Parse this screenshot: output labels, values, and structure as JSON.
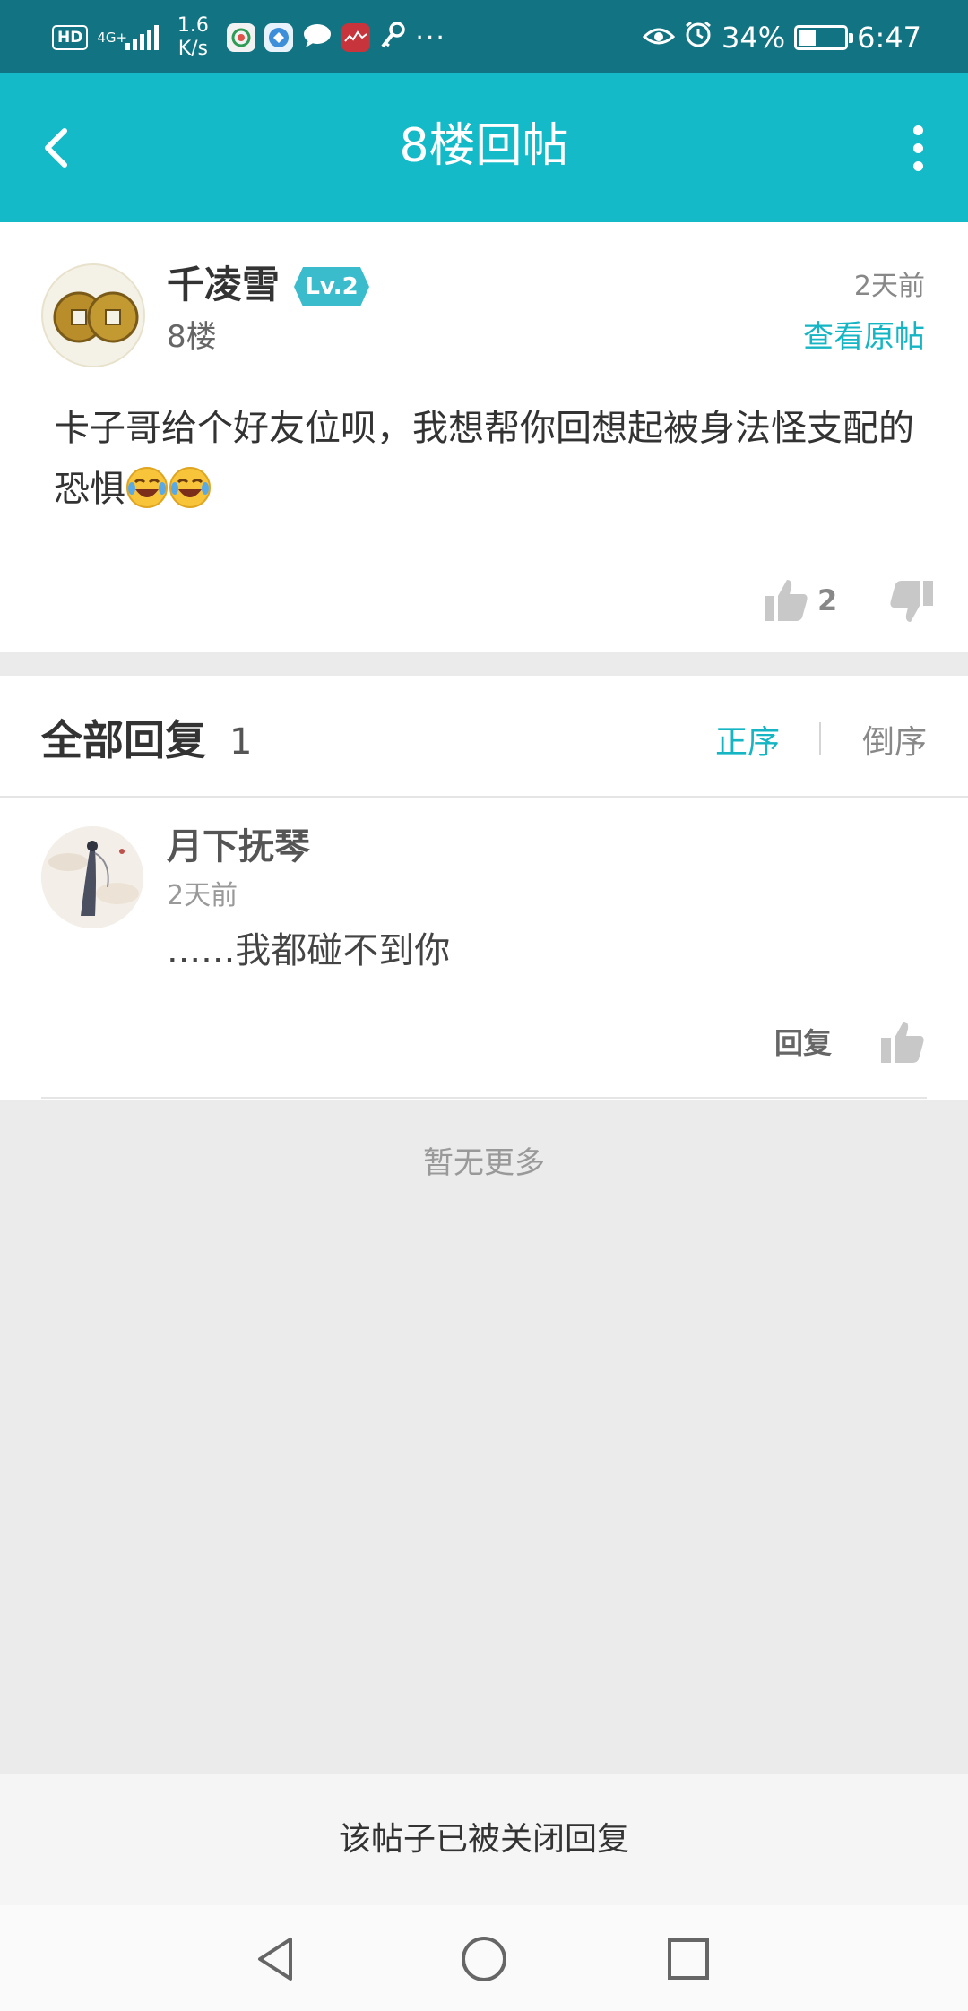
{
  "status_bar": {
    "hd": "HD",
    "network": "4G+",
    "speed_value": "1.6",
    "speed_unit": "K/s",
    "more_notifications": "···",
    "battery": "34%",
    "time": "6:47"
  },
  "app_bar": {
    "title": "8楼回帖"
  },
  "post": {
    "author": "千凌雪",
    "level": "Lv.2",
    "floor": "8楼",
    "time": "2天前",
    "view_original": "查看原帖",
    "content": "卡子哥给个好友位呗，我想帮你回想起被身法怪支配的恐惧",
    "like_count": "2"
  },
  "replies": {
    "title": "全部回复",
    "count": "1",
    "sort_asc": "正序",
    "sort_desc": "倒序",
    "items": [
      {
        "author": "月下抚琴",
        "time": "2天前",
        "text": "......我都碰不到你",
        "reply_label": "回复"
      }
    ]
  },
  "no_more": "暂无更多",
  "closed_notice": "该帖子已被关闭回复",
  "colors": {
    "accent": "#15bac9",
    "status_bar": "#127482",
    "link": "#15b5c4"
  }
}
